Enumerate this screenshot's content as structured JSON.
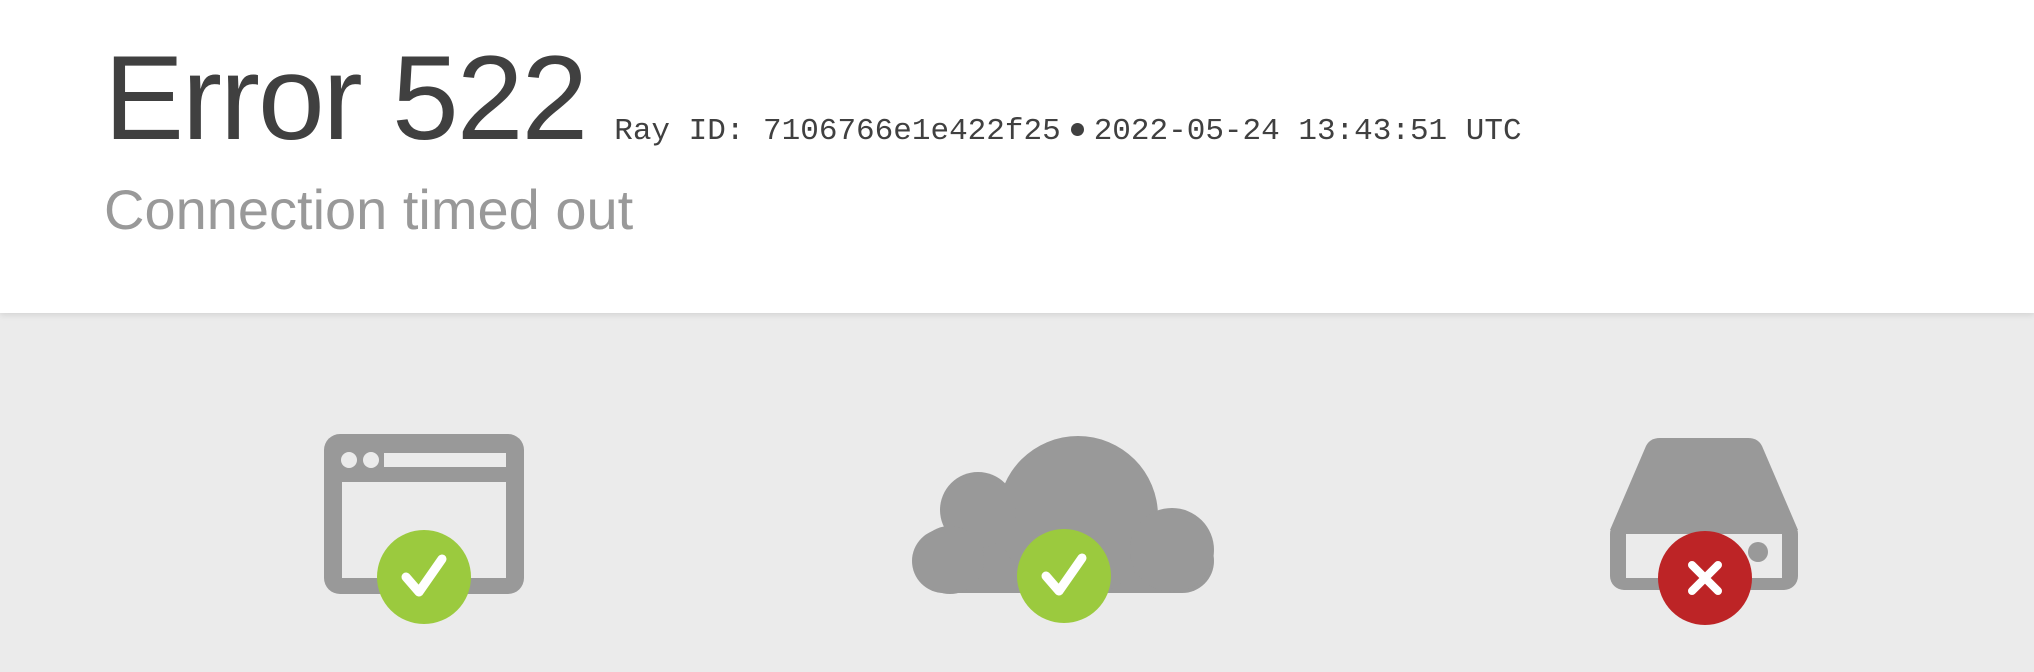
{
  "header": {
    "title": "Error 522",
    "ray_id_label": "Ray ID: 7106766e1e422f25",
    "timestamp": "2022-05-24 13:43:51 UTC",
    "subtitle": "Connection timed out"
  },
  "status_icons": [
    {
      "icon": "browser-icon",
      "status": "ok",
      "badge": "checkmark-icon"
    },
    {
      "icon": "cloud-icon",
      "status": "ok",
      "badge": "checkmark-icon"
    },
    {
      "icon": "server-icon",
      "status": "error",
      "badge": "x-icon"
    }
  ],
  "colors": {
    "header_bg": "#ffffff",
    "page_bg": "#ebebeb",
    "icon_gray": "#999999",
    "ok_green": "#9bca3e",
    "error_red": "#bd2426",
    "title_text": "#404040",
    "subtitle_text": "#999999"
  }
}
